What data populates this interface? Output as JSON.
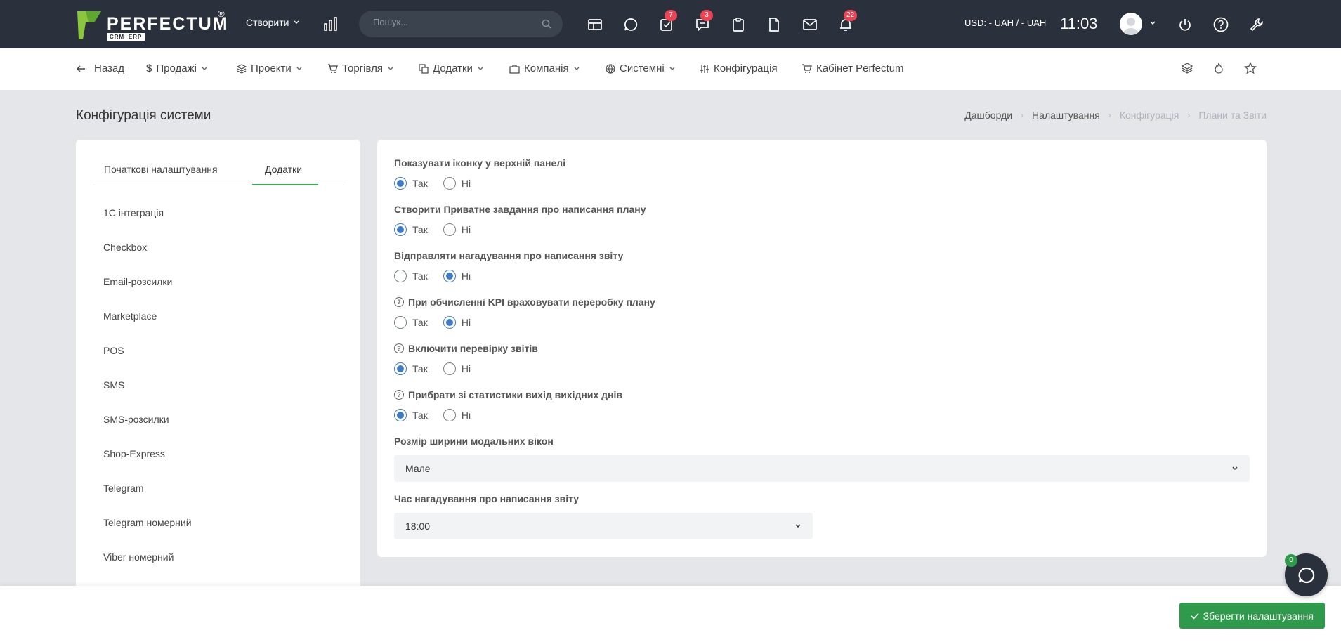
{
  "topbar": {
    "logo_text": "PERFECTUM",
    "logo_reg": "®",
    "logo_sub": "CRM+ERP",
    "create_label": "Створити",
    "search_placeholder": "Пошук...",
    "badges": {
      "tasks": "7",
      "messages": "3",
      "notifications": "22"
    },
    "currency": "USD: - UAH / - UAH",
    "time": "11:03"
  },
  "nav": {
    "items": [
      {
        "label": "Назад",
        "icon": "arrow-left-icon"
      },
      {
        "label": "Продажі",
        "icon": "dollar-icon"
      },
      {
        "label": "Проекти",
        "icon": "layers-icon"
      },
      {
        "label": "Торгівля",
        "icon": "cart-icon"
      },
      {
        "label": "Додатки",
        "icon": "copy-icon"
      },
      {
        "label": "Компанія",
        "icon": "briefcase-icon"
      },
      {
        "label": "Системні",
        "icon": "globe-icon"
      },
      {
        "label": "Конфігурація",
        "icon": "sliders-icon"
      },
      {
        "label": "Кабінет Perfectum",
        "icon": "cart-icon"
      }
    ]
  },
  "page": {
    "title": "Конфігурація системи",
    "breadcrumb": [
      "Дашборди",
      "Налаштування",
      "Конфігурація",
      "Плани та Звіти"
    ]
  },
  "left": {
    "tabs": [
      "Початкові налаштування",
      "Додатки"
    ],
    "items": [
      "1С інтеграція",
      "Checkbox",
      "Email-розсилки",
      "Marketplace",
      "POS",
      "SMS",
      "SMS-розсилки",
      "Shop-Express",
      "Telegram",
      "Telegram номерний",
      "Viber номерний"
    ]
  },
  "settings": {
    "yes": "Так",
    "no": "Ні",
    "fields": [
      {
        "label": "Показувати іконку у верхній панелі",
        "value": "yes",
        "help": false
      },
      {
        "label": "Створити Приватне завдання про написання плану",
        "value": "yes",
        "help": false
      },
      {
        "label": "Відправляти нагадування про написання звіту",
        "value": "no",
        "help": false
      },
      {
        "label": "При обчисленні KPI враховувати переробку плану",
        "value": "no",
        "help": true
      },
      {
        "label": "Включити перевірку звітів",
        "value": "yes",
        "help": true
      },
      {
        "label": "Прибрати зі статистики вихід вихідних днів",
        "value": "yes",
        "help": true
      }
    ],
    "modal_width_label": "Розмір ширини модальних вікон",
    "modal_width_value": "Мале",
    "reminder_time_label": "Час нагадування про написання звіту",
    "reminder_time_value": "18:00"
  },
  "footer": {
    "save_label": "Зберегти налаштування",
    "chat_badge": "0"
  },
  "colors": {
    "topbar": "#2a313c",
    "accent_green": "#2f9a4b",
    "radio_blue": "#3d7bc6",
    "badge_red": "#e84557"
  }
}
